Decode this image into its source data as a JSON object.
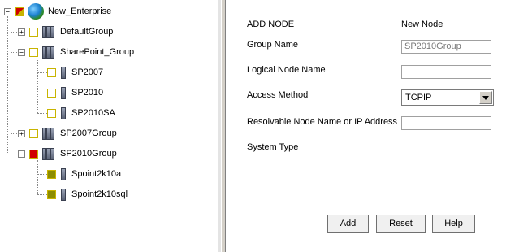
{
  "tree": {
    "root": {
      "label": "New_Enterprise",
      "icon": "globe-icon"
    },
    "groups": [
      {
        "label": "DefaultGroup",
        "expander": "+"
      },
      {
        "label": "SharePoint_Group",
        "expander": "−",
        "children": [
          "SP2007",
          "SP2010",
          "SP2010SA"
        ]
      },
      {
        "label": "SP2007Group",
        "expander": "+"
      },
      {
        "label": "SP2010Group",
        "expander": "−",
        "children": [
          "Spoint2k10a",
          "Spoint2k10sql"
        ]
      }
    ]
  },
  "form": {
    "heading": "ADD NODE",
    "heading_value": "New Node",
    "group_name_label": "Group Name",
    "group_name_value": "SP2010Group",
    "logical_node_label": "Logical Node Name",
    "logical_node_value": "",
    "access_method_label": "Access Method",
    "access_method_value": "TCPIP",
    "resolvable_label": "Resolvable Node Name or IP Address",
    "resolvable_value": "",
    "system_type_label": "System Type"
  },
  "buttons": {
    "add": "Add",
    "reset": "Reset",
    "help": "Help"
  }
}
